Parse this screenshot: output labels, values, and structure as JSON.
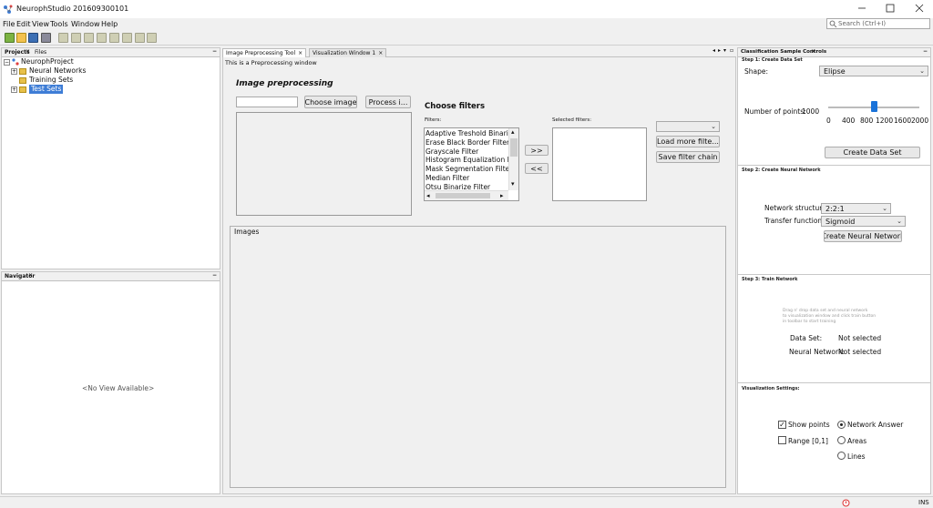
{
  "window": {
    "title": "NeurophStudio 201609300101",
    "controls": [
      "minimize",
      "maximize",
      "close"
    ]
  },
  "menu": [
    "File",
    "Edit",
    "View",
    "Tools",
    "Window",
    "Help"
  ],
  "search": {
    "placeholder": "Search (Ctrl+I)"
  },
  "projects_panel": {
    "tabs": [
      "Projects",
      "Files"
    ],
    "tree": {
      "root": "NeurophProject",
      "children": [
        "Neural Networks",
        "Training Sets",
        "Test Sets"
      ],
      "selected": "Test Sets"
    }
  },
  "navigator_panel": {
    "tab": "Navigator",
    "empty_text": "<No View Available>"
  },
  "editor": {
    "tabs": [
      "Image Preprocessing Tool",
      "Visualization Window 1"
    ],
    "info_text": "This is a Preprocessing window",
    "heading": "Image preprocessing",
    "choose_image_label": "Choose image",
    "process_label": "Process i...",
    "choose_filters_heading": "Choose filters",
    "filters_label": "Filters:",
    "selected_filters_label": "Selected filters:",
    "filters": [
      "Adaptive Treshold Binarize F",
      "Erase Black Border Filter",
      "Grayscale Filter",
      "Histogram Equalization Filter",
      "Mask Segmentation Filter",
      "Median Filter",
      "Otsu Binarize Filter"
    ],
    "add_label": ">>",
    "remove_label": "<<",
    "load_more_label": "Load more filte...",
    "save_chain_label": "Save filter chain",
    "images_label": "Images"
  },
  "controls_panel": {
    "tab": "Classification Sample Controls",
    "step1": {
      "title": "Step 1: Create Data Set",
      "shape_label": "Shape:",
      "shape_value": "Elipse",
      "points_label": "Number of points:",
      "points_value": "1000",
      "slider_ticks": [
        "0",
        "400",
        "800",
        "1200",
        "1600",
        "2000"
      ],
      "slider_min": 0,
      "slider_max": 2000,
      "slider_value": 1000,
      "create_label": "Create Data Set"
    },
    "step2": {
      "title": "Step 2: Create Neural Network",
      "structure_label": "Network structure:",
      "structure_value": "2:2:1",
      "transfer_label": "Transfer function:",
      "transfer_value": "Sigmoid",
      "create_label": "Create Neural Network"
    },
    "step3": {
      "title": "Step 3: Train Network",
      "hint_lines": [
        "Drag n' drop data set and neural network",
        "to visualization window and click train button",
        "in toolbar to start training"
      ],
      "dataset_label": "Data Set:",
      "dataset_value": "Not selected",
      "network_label": "Neural Network:",
      "network_value": "Not selected"
    },
    "settings": {
      "title": "Visualization Settings:",
      "show_points_label": "Show points",
      "show_points_checked": true,
      "range_label": "Range [0,1]",
      "range_checked": false,
      "radios": [
        "Network Answer",
        "Areas",
        "Lines"
      ],
      "selected_radio": "Network Answer"
    }
  },
  "statusbar": {
    "mode": "INS"
  },
  "colors": {
    "accent": "#3e7dd6",
    "selection": "#3e7dd6",
    "slider_thumb": "#1a73d9"
  }
}
